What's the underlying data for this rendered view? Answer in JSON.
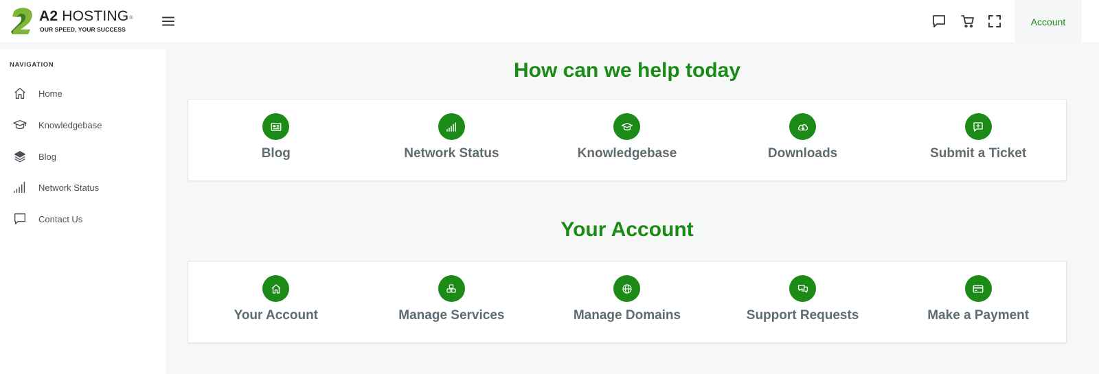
{
  "brand": {
    "name_bold": "A2",
    "name_rest": " HOSTING",
    "registered": "®",
    "tagline": "OUR SPEED, YOUR SUCCESS",
    "colors": {
      "primary_green": "#1b8a17",
      "logo_green": "#7fb539",
      "logo_dark_green": "#3d7d1e"
    }
  },
  "topbar": {
    "icons": [
      "menu-icon",
      "chat-icon",
      "cart-icon",
      "fullscreen-icon"
    ],
    "account_label": "Account"
  },
  "sidebar": {
    "heading": "NAVIGATION",
    "items": [
      {
        "label": "Home",
        "icon": "home-icon"
      },
      {
        "label": "Knowledgebase",
        "icon": "graduation-cap-icon"
      },
      {
        "label": "Blog",
        "icon": "layers-icon"
      },
      {
        "label": "Network Status",
        "icon": "signal-bars-icon"
      },
      {
        "label": "Contact Us",
        "icon": "chat-icon"
      }
    ]
  },
  "help": {
    "title": "How can we help today",
    "tiles": [
      {
        "label": "Blog",
        "icon": "newspaper-icon"
      },
      {
        "label": "Network Status",
        "icon": "signal-bars-icon"
      },
      {
        "label": "Knowledgebase",
        "icon": "graduation-cap-icon"
      },
      {
        "label": "Downloads",
        "icon": "cloud-download-icon"
      },
      {
        "label": "Submit a Ticket",
        "icon": "message-plus-icon"
      }
    ]
  },
  "account": {
    "title": "Your Account",
    "tiles": [
      {
        "label": "Your Account",
        "icon": "home-icon"
      },
      {
        "label": "Manage Services",
        "icon": "cubes-icon"
      },
      {
        "label": "Manage Domains",
        "icon": "globe-icon"
      },
      {
        "label": "Support Requests",
        "icon": "chat-bubbles-icon"
      },
      {
        "label": "Make a Payment",
        "icon": "credit-card-icon"
      }
    ]
  }
}
